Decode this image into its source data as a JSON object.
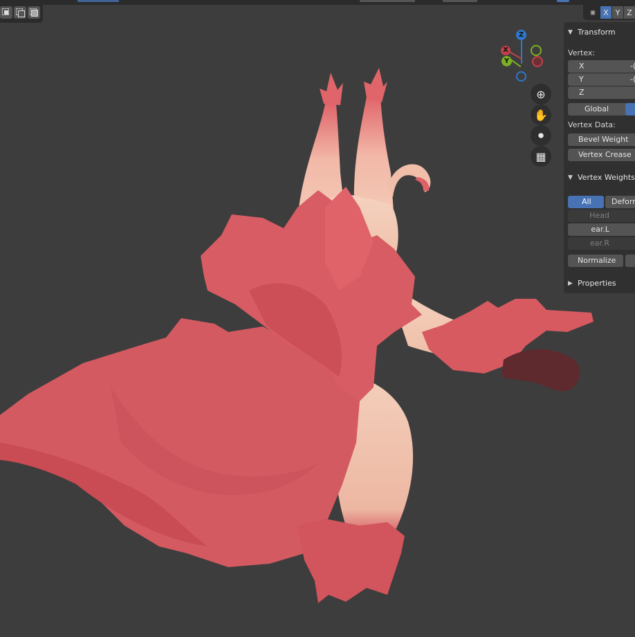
{
  "header": {
    "select_modes": [
      "vertex-select-icon",
      "edge-select-icon",
      "face-select-icon"
    ],
    "mirror": {
      "icon": "butterfly-mirror-icon",
      "axes": [
        {
          "label": "X",
          "active": true
        },
        {
          "label": "Y",
          "active": false
        },
        {
          "label": "Z",
          "active": false
        }
      ]
    }
  },
  "gizmo": {
    "z_label": "Z",
    "x_label": "X",
    "y_label": "Y",
    "colors": {
      "x": "#c2404a",
      "y": "#7cb024",
      "z": "#2e78cc"
    }
  },
  "nav_buttons": [
    "zoom-icon",
    "hand-pan-icon",
    "camera-icon",
    "grid-view-icon"
  ],
  "npanel": {
    "transform_title": "Transform",
    "vertex_label": "Vertex:",
    "fields": [
      {
        "axis": "X",
        "value": "-("
      },
      {
        "axis": "Y",
        "value": "-("
      },
      {
        "axis": "Z",
        "value": ""
      }
    ],
    "global_label": "Global",
    "vertex_data_label": "Vertex Data:",
    "bevel_weight": "Bevel Weight",
    "vertex_crease": "Vertex Crease",
    "vertex_weights_title": "Vertex Weights",
    "vw_tabs": {
      "all": "All",
      "deform": "Deform"
    },
    "vw_groups": [
      {
        "name": "Head",
        "value": "",
        "active": false
      },
      {
        "name": "ear.L",
        "value": "(",
        "active": true
      },
      {
        "name": "ear.R",
        "value": "(",
        "active": false
      }
    ],
    "normalize": "Normalize",
    "properties_title": "Properties"
  },
  "colors": {
    "viewport_bg": "#3d3d3d",
    "panel_bg": "#303030",
    "accent": "#4772b3",
    "fur_red": "#d4555c",
    "skin": "#f2c8b4"
  }
}
